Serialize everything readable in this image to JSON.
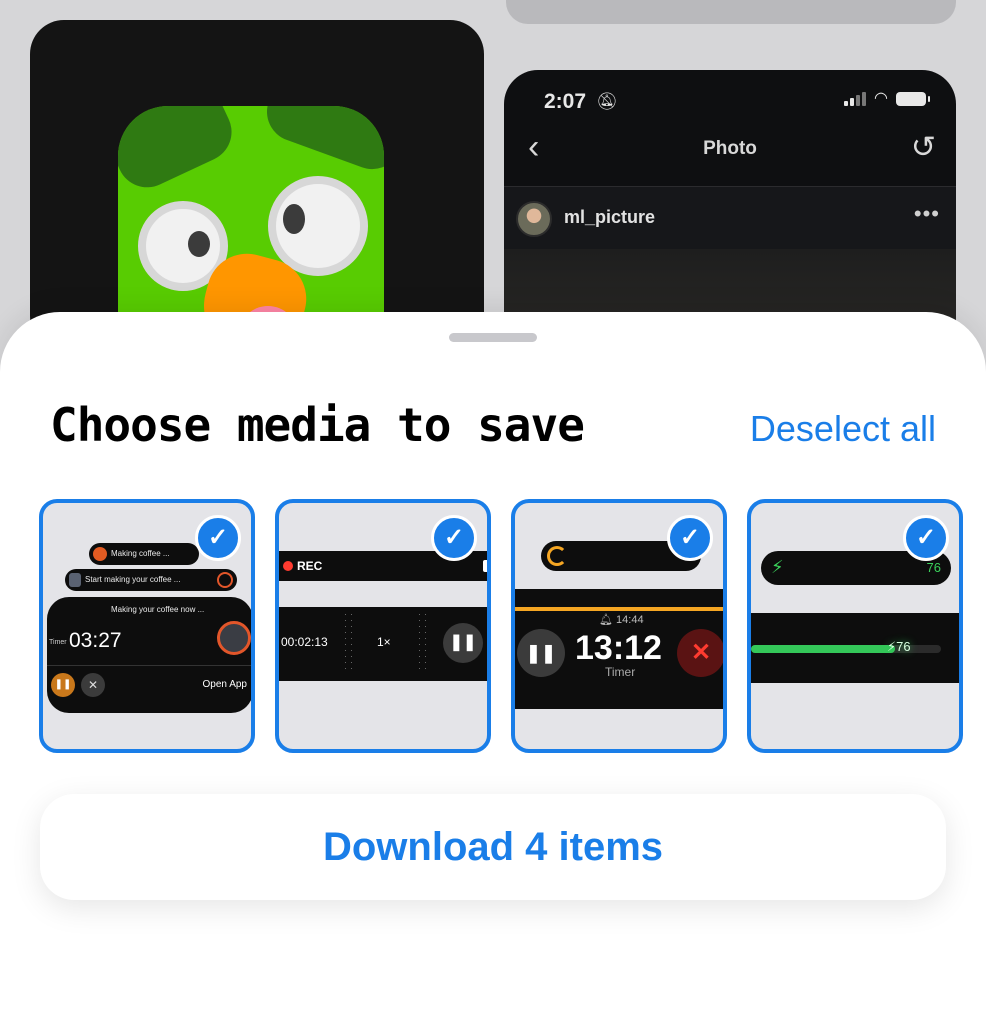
{
  "background": {
    "status_bar": {
      "time": "2:07"
    },
    "photo_view": {
      "title": "Photo",
      "username": "ml_picture"
    }
  },
  "sheet": {
    "title": "Choose media to save",
    "deselect_label": "Deselect all",
    "download_label": "Download 4 items",
    "accent_color": "#1a7ee8"
  },
  "thumbnails": [
    {
      "selected": true,
      "pill1_text": "Making coffee ...",
      "pill2_text": "Start making your coffee ...",
      "main_caption": "Making your coffee now ...",
      "time": "03:27",
      "timer_label": "Timer",
      "open_label": "Open App"
    },
    {
      "selected": true,
      "rec_label": "REC",
      "time": "00:02:13",
      "zoom": "1×"
    },
    {
      "selected": true,
      "alarm_time": "14:44",
      "time": "13:12",
      "timer_label": "Timer"
    },
    {
      "selected": true,
      "battery_value": "76",
      "battery_fill": 0.76
    }
  ]
}
